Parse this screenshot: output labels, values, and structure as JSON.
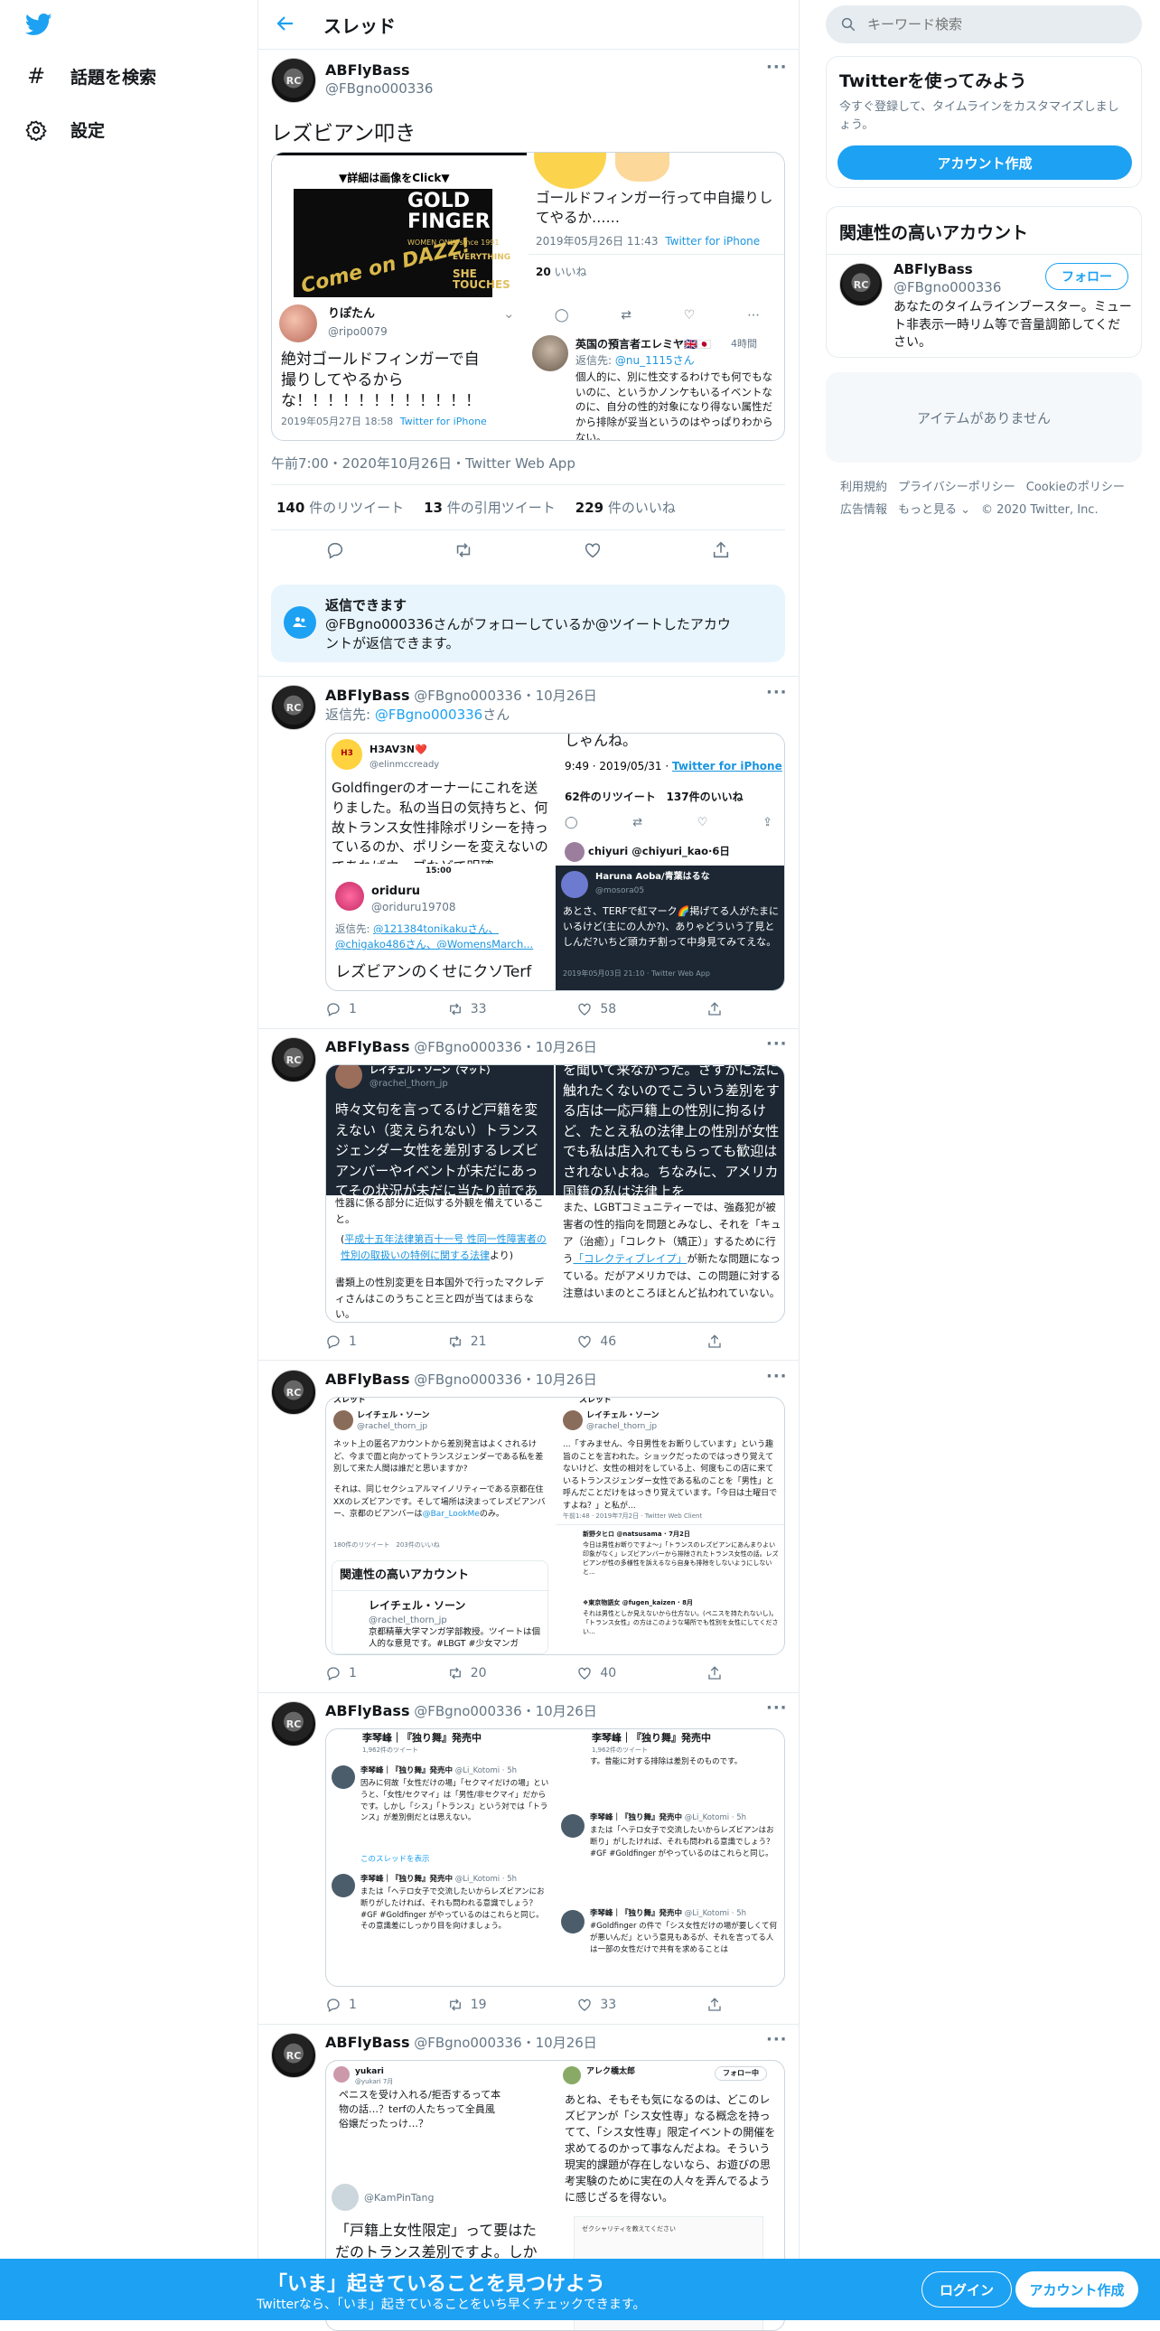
{
  "nav": {
    "explore": "話題を検索",
    "settings": "設定"
  },
  "header": {
    "title": "スレッド"
  },
  "main_tweet": {
    "name": "ABFlyBass",
    "handle": "@FBgno000336",
    "text": "レズビアン叩き",
    "meta": "午前7:00・2020年10月26日・Twitter Web App",
    "retweets_count": "140",
    "retweets_label": "件のリツイート",
    "quotes_count": "13",
    "quotes_label": "件の引用ツイート",
    "likes_count": "229",
    "likes_label": "件のいいね",
    "media": {
      "poster_caption": "▼詳細は画像をClick▼",
      "poster_title": "GOLD FINGER",
      "poster_sub": "WOMEN ONLY since 1991",
      "poster_come": "Come on DAZZ!",
      "poster_everything": "EVERYTHING",
      "poster_she": "SHE TOUCHES",
      "tr_text": "ゴールドフィンガー行って中自撮りしてやるか……",
      "tr_time": "2019年05月26日 11:43",
      "tr_client": "Twitter for iPhone",
      "tr_likes": "20",
      "tr_likes_label": "いいね",
      "bl_name": "りぽたん",
      "bl_handle": "@ripo0079",
      "bl_text": "絶対ゴールドフィンガーで自撮りしてやるからな！！！！！！！！！！！！",
      "bl_time": "2019年05月27日 18:58",
      "bl_client": "Twitter for iPhone",
      "br_name": "英国の預言者エレミヤ🇬🇧🇯🇵",
      "br_time": "4時間",
      "br_reply_prefix": "返信先:",
      "br_reply_to": "@nu_1115さん",
      "br_text": "個人的に、別に性交するわけでも何でもないのに、というかノンケもいるイベントなのに、自分の性的対象になり得ない属性だから排除が妥当というのはやっぱりわからない。"
    }
  },
  "reply_notice": {
    "title": "返信できます",
    "text": "@FBgno000336さんがフォローしているか@ツイートしたアカウントが返信できます。"
  },
  "replies": [
    {
      "name": "ABFlyBass",
      "meta": "@FBgno000336・10月26日",
      "reply_prefix": "返信先:",
      "reply_to": "@FBgno000336",
      "reply_suffix": "さん",
      "replies": "1",
      "retweets": "33",
      "likes": "58",
      "media": {
        "tl_name": "H3AV3N❤️",
        "tl_handle": "@elinmccready",
        "tl_text": "Goldfingerのオーナーにこれを送りました。私の当日の気持ちと、何故トランス女性排除ポリシーを持っているのか、ポリシーを変えないのであればウェブなどで明確",
        "tr_top": "しゃんね。",
        "tr_time": "9:49 · 2019/05/31 · ",
        "tr_client": "Twitter for iPhone",
        "tr_rt": "62",
        "tr_rt_label": "件のリツイート",
        "tr_like": "137",
        "tr_like_label": "件のいいね",
        "tr_next": "chiyuri @chiyuri_kao·6日",
        "bl_status": "15:00",
        "bl_name": "oriduru",
        "bl_handle": "@oriduru19708",
        "bl_reply_prefix": "返信先:",
        "bl_reply_to": "@121384tonikakuさん、@chigako486さん、@WomensMarch...",
        "bl_text": "レズビアンのくせにクソTerf",
        "br_name": "Haruna Aoba/青葉はるな",
        "br_handle": "@mosora05",
        "br_text": "あとさ、TERFで紅マーク🌈掲げてる人がたまにいるけど(主にの人か?)、ありゃどういう了見としんだ?いちど頭カチ割って中身見てみてえな。",
        "br_time": "2019年05月03日 21:10 · Twitter Web App"
      }
    },
    {
      "name": "ABFlyBass",
      "meta": "@FBgno000336・10月26日",
      "replies": "1",
      "retweets": "21",
      "likes": "46",
      "media": {
        "tl_name": "レイチェル・ソーン（マット）",
        "tl_handle": "@rachel_thorn_jp",
        "tl_text": "時々文句を言ってるけど戸籍を変えない（変えられない）トランスジェンダー女性を差別するレズビアンバーやイベントが未だにあってその状況が未だに当たり前であ",
        "tr_text": "を聞いて来なかった。さすがに法に触れたくないのでこういう差別をする店は一応戸籍上の性別に拘るけど、たとえ私の法律上の性別が女性でも私は店入れてもらっても歓迎はされないよね。ちなみに、アメリカ国籍の私は法律上を",
        "bl_text1": "性器に係る部分に近似する外観を備えていること。",
        "bl_law": "平成十五年法律第百十一号 性同一性障害者の性別の取扱いの特例に関する法律",
        "bl_law_suffix": "より)",
        "bl_text2": "書類上の性別変更を日本国外で行ったマクレディさんはこのうちこと三と四が当てはまらない。",
        "br_text1": "また、LGBTコミュニティーでは、強姦犯が被害者の性的指向を問題とみなし、それを「キュア（治癒）」「コレクト（矯正）」するために行う",
        "br_link": "「コレクティブレイプ」",
        "br_text2": "が新たな問題になっている。だがアメリカでは、この問題に対する注意はいまのところほとんど払われていない。"
      }
    },
    {
      "name": "ABFlyBass",
      "meta": "@FBgno000336・10月26日",
      "replies": "1",
      "retweets": "20",
      "likes": "40",
      "media": {
        "tl_header": "スレッド",
        "tl_name": "レイチェル・ソーン",
        "tl_handle": "@rachel_thorn_jp",
        "tl_text1": "ネット上の匿名アカウントから差別発言はよくされるけど、今まで面と向かってトランスジェンダーである私を差別して来た人間は誰だと思いますか?",
        "tl_text2": "それは、同じセクシュアルマイノリティーである京都在住XXのレズビアンです。そして場所は決まってレズビアンバー、京都のビアンバーは",
        "tl_link": "@Bar_LookMe",
        "tl_text3": "のみ。",
        "tl_stats": "180件のリツイート　203件のいいね",
        "tl_related": "関連性の高いアカウント",
        "tl_rel_name": "レイチェル・ソーン",
        "tl_rel_handle": "@rachel_thorn_jp",
        "tl_rel_text": "京都精華大学マンガ学部教授。ツイートは個人的な意見です。#LBGT #少女マンガ",
        "tr_header": "スレッド",
        "tr_name": "レイチェル・ソーン",
        "tr_handle": "@rachel_thorn_jp",
        "tr_text": "...「すみません、今日男性をお断りしています」という趣旨のことを言われた。ショックだったのではっきり覚えてないけど、女性の相対をしている上、何度もこの店に来ているトランスジェンダー女性である私のことを「男性」と呼んだことだけをはっきり覚えています。「今日は土曜日ですよね？」と私が...",
        "tr_time": "午前1:48 · 2019年7月2日 · Twitter Web Client",
        "tr_r1_name": "新野タヒロ @natsusama · 7月2日",
        "tr_r1_text": "今日は男性お断りですよ〜」「トランスのレズビアンにあんまりよい印象がなく」レズビアンバーから排除されたトランス女性の話。レズビアンが性の多様性を訴えるなら自身も排除をしないようにしないと...",
        "tr_r2_name": "❖東京物語女 @fugen_kaizen · 8月",
        "tr_r2_text": "それは男性としか見えないから仕方ない。(ペニスを持たれないし)。「トランス女性」の方はこのような場所でも性別を女性にしてください..."
      }
    },
    {
      "name": "ABFlyBass",
      "meta": "@FBgno000336・10月26日",
      "replies": "1",
      "retweets": "19",
      "likes": "33",
      "media": {
        "tl_title": "李琴峰｜『独り舞』発売中",
        "tl_sub": "1,962件のツイート",
        "tl_name": "李琴峰｜『独り舞』発売中",
        "tl_handle": "@Li_Kotomi · 5h",
        "tl_text": "因みに何故「女性だけの場」「セクマイだけの場」というと、「女性/セクマイ」は「男性/非セクマイ」だからです。しかし「シス」「トランス」という対では「トランス」が差別側だとは思えない。",
        "tl_link": "このスレッドを表示",
        "tl_name2": "李琴峰｜『独り舞』発売中",
        "tl_handle2": "@Li_Kotomi · 5h",
        "tl_text2": "または「ヘテロ女子で交流したいからレズビアンにお断りがしたければ、それも問われる意識でしょう？#GF #Goldfinger がやっているのはこれらと同じ。その意識差にしっかり目を向けましょう。",
        "tr_title": "李琴峰｜『独り舞』発売中",
        "tr_sub": "1,962件のツイート",
        "tr_top": "す。昔能に対する排除は差別そのものです。",
        "tr_name": "李琴峰｜『独り舞』発売中",
        "tr_handle": "@Li_Kotomi · 5h",
        "tr_text": "または「ヘテロ女子で交流したいからレズビアンはお断り」がしたければ、それも問われる意識でしょう？#GF #Goldfinger がやっているのはこれらと同じ。",
        "tr_name2": "李琴峰｜『独り舞』発売中",
        "tr_handle2": "@Li_Kotomi · 5h",
        "tr_text2": "#Goldfinger の件で「シス女性だけの場が要しくて何が悪いんだ」という意見もあるが、それを言ってる人は一部の女性だけで共有を求めることは"
      }
    },
    {
      "name": "ABFlyBass",
      "meta": "@FBgno000336・10月26日",
      "media": {
        "tl_name": "yukari",
        "tl_handle": "@yukari 7月",
        "tl_text": "ペニスを受け入れる/拒否するって本物の話…？terfの人たちって全員風俗嬢だったっけ…？",
        "tl_handle2": "@KamPinTang",
        "tl_text2": "「戸籍上女性限定」って要はただのトランス差別ですよ。しかも同",
        "tr_name": "アレク橋太郎",
        "tr_follow": "フォロー中",
        "tr_text": "あとね、そもそも気になるのは、どこのレズビアンが「シス女性専」なる概念を持ってて、「シス女性専」限定イベントの開催を求めてるのかって事なんだよね。そういう現実的課題が存在しないなら、お遊びの思考実験のために実在の人々を弄んでるように感じざるを得ない。",
        "tr_sub": "ゼクシャリティを教えてください"
      }
    }
  ],
  "sidebar": {
    "search_placeholder": "キーワード検索",
    "signup_title": "Twitterを使ってみよう",
    "signup_text": "今すぐ登録して、タイムラインをカスタマイズしましょう。",
    "signup_button": "アカウント作成",
    "related_title": "関連性の高いアカウント",
    "related_name": "ABFlyBass",
    "related_handle": "@FBgno000336",
    "related_bio": "あなたのタイムラインブースター。ミュート非表示一時リム等で音量調節してください。",
    "follow_button": "フォロー",
    "empty_text": "アイテムがありません",
    "footer_links": [
      "利用規約",
      "プライバシーポリシー",
      "Cookieのポリシー",
      "広告情報",
      "もっと見る ⌄",
      "© 2020 Twitter, Inc."
    ]
  },
  "bottom_bar": {
    "title": "「いま」起きていることを見つけよう",
    "subtitle": "Twitterなら、「いま」起きていることをいち早くチェックできます。",
    "login": "ログイン",
    "signup": "アカウント作成"
  },
  "colors": {
    "accent": "#1da1f2",
    "link": "#1b95e0",
    "gray": "#657786",
    "border": "#e6ecf0",
    "bottom_bar": "#1da1f2",
    "notice_bg": "#e8f5fd"
  },
  "icons": [
    "twitter-logo-icon",
    "hashtag-icon",
    "gear-icon",
    "back-arrow-icon",
    "search-icon",
    "more-icon",
    "reply-icon",
    "retweet-icon",
    "like-icon",
    "share-icon",
    "people-icon"
  ]
}
